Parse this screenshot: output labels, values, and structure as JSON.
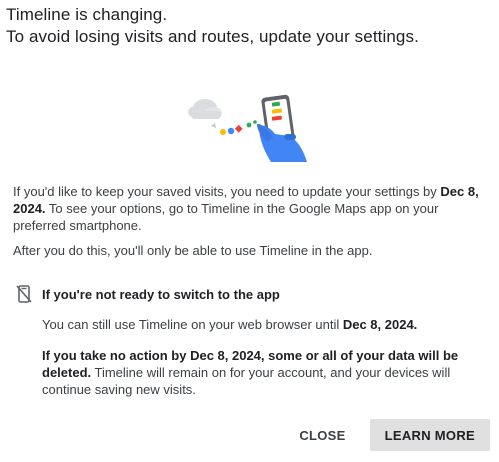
{
  "title": {
    "line1": "Timeline is changing.",
    "line2": "To avoid losing visits and routes, update your settings."
  },
  "illustration": {
    "name": "cloud-to-phone-illustration",
    "colors": {
      "cloud": "#dadce0",
      "blue": "#4285f4",
      "red": "#ea4335",
      "yellow": "#fbbc04",
      "green": "#34a853",
      "phone_body": "#e8eaed",
      "hand": "#3b78e7"
    }
  },
  "paragraphs": {
    "p1_part1": "If you'd like to keep your saved visits, you need to update your settings by ",
    "p1_bold": "Dec 8, 2024.",
    "p1_part2": " To see your options, go to Timeline in the Google Maps app on your preferred smartphone.",
    "p2": "After you do this, you'll only be able to use Timeline in the app."
  },
  "notice": {
    "icon": "phone-off-icon",
    "heading": "If you're not ready to switch to the app",
    "p3_part1": "You can still use Timeline on your web browser until ",
    "p3_bold": "Dec 8, 2024.",
    "p4_bold": "If you take no action by Dec 8, 2024, some or all of your data will be deleted.",
    "p4_part2": " Timeline will remain on for your account, and your devices will continue saving new visits."
  },
  "actions": {
    "close_label": "CLOSE",
    "learn_more_label": "LEARN MORE"
  }
}
